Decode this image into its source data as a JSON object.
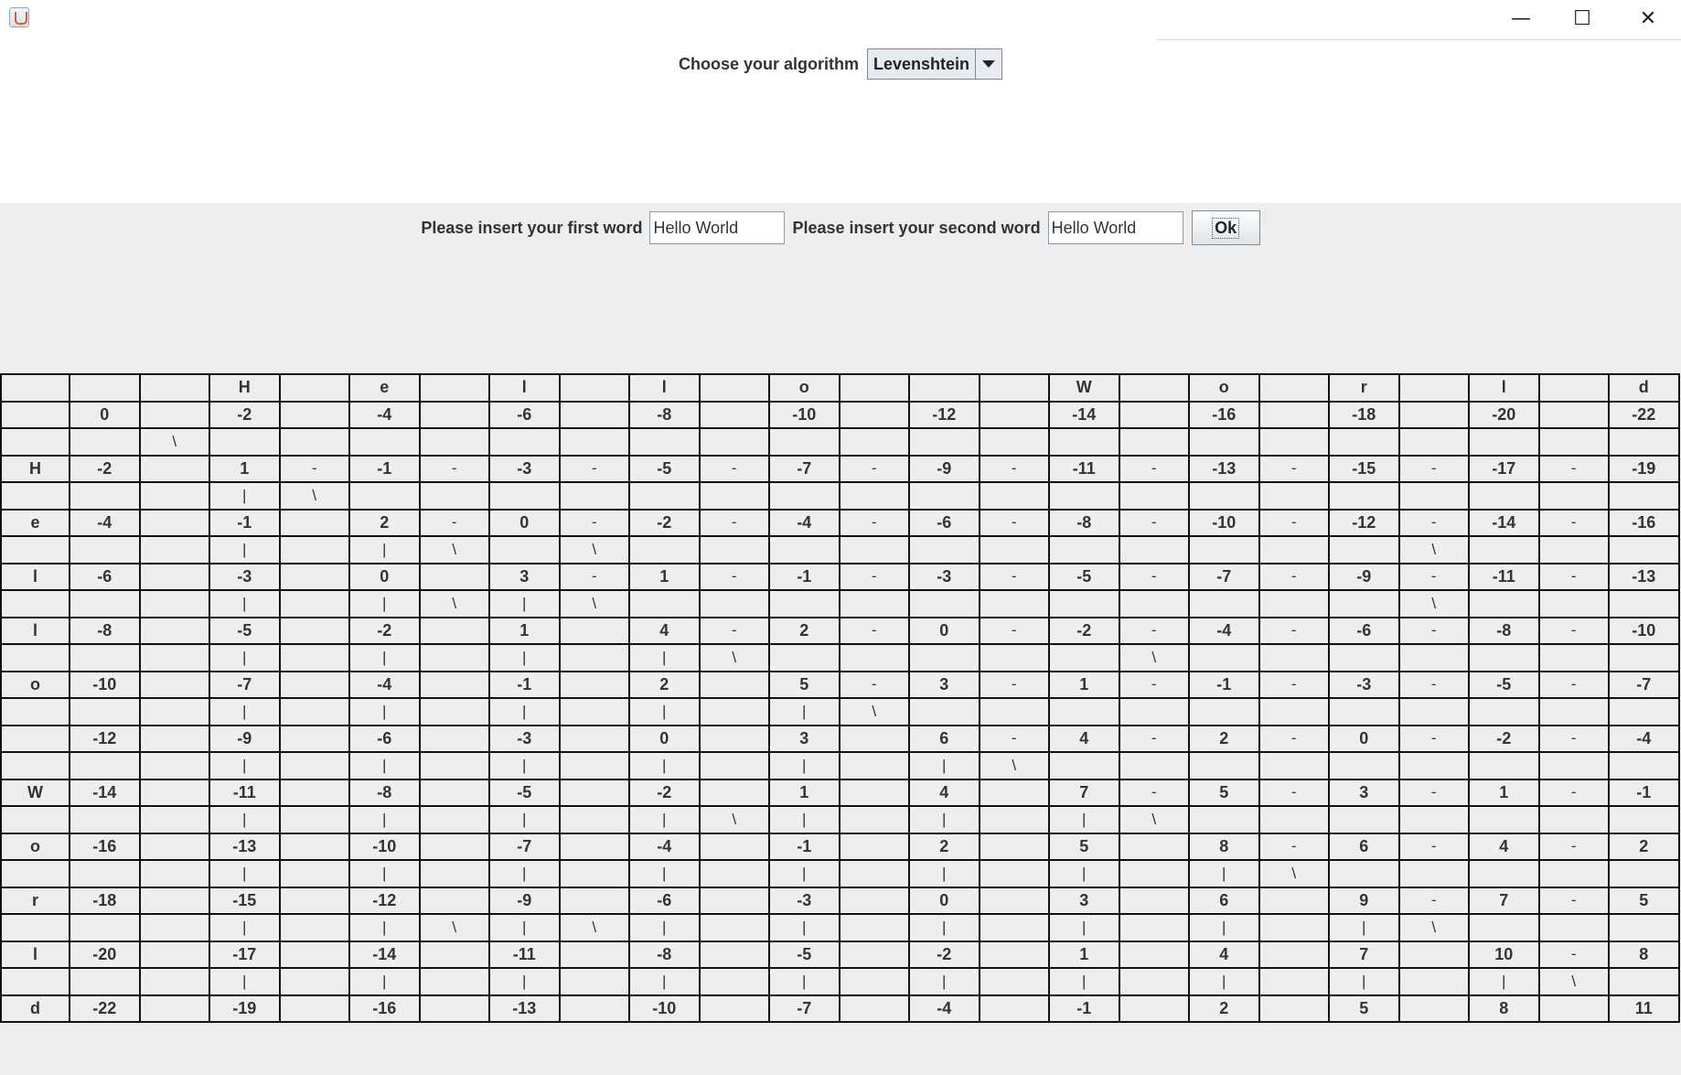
{
  "window": {
    "icon": "java-app-icon",
    "controls": {
      "minimize": "—",
      "maximize": "☐",
      "close": "✕"
    }
  },
  "algorithm": {
    "label": "Choose your algorithm",
    "selected": "Levenshtein"
  },
  "inputs": {
    "first_label": "Please insert your first word",
    "first_value": "Hello World",
    "second_label": "Please insert your second word",
    "second_value": "Hello World",
    "ok_label": "Ok"
  },
  "matrix": {
    "rows": [
      [
        "",
        "",
        "",
        "H",
        "",
        "e",
        "",
        "l",
        "",
        "l",
        "",
        "o",
        "",
        "",
        "",
        "W",
        "",
        "o",
        "",
        "r",
        "",
        "l",
        "",
        "d"
      ],
      [
        "",
        "0",
        "",
        "-2",
        "",
        "-4",
        "",
        "-6",
        "",
        "-8",
        "",
        "-10",
        "",
        "-12",
        "",
        "-14",
        "",
        "-16",
        "",
        "-18",
        "",
        "-20",
        "",
        "-22"
      ],
      [
        "",
        "",
        "\\",
        "",
        "",
        "",
        "",
        "",
        "",
        "",
        "",
        "",
        "",
        "",
        "",
        "",
        "",
        "",
        "",
        "",
        "",
        "",
        "",
        ""
      ],
      [
        "H",
        "-2",
        "",
        "1",
        "-",
        "-1",
        "-",
        "-3",
        "-",
        "-5",
        "-",
        "-7",
        "-",
        "-9",
        "-",
        "-11",
        "-",
        "-13",
        "-",
        "-15",
        "-",
        "-17",
        "-",
        "-19"
      ],
      [
        "",
        "",
        "",
        "|",
        "\\",
        "",
        "",
        "",
        "",
        "",
        "",
        "",
        "",
        "",
        "",
        "",
        "",
        "",
        "",
        "",
        "",
        "",
        "",
        ""
      ],
      [
        "e",
        "-4",
        "",
        "-1",
        "",
        "2",
        "-",
        "0",
        "-",
        "-2",
        "-",
        "-4",
        "-",
        "-6",
        "-",
        "-8",
        "-",
        "-10",
        "-",
        "-12",
        "-",
        "-14",
        "-",
        "-16"
      ],
      [
        "",
        "",
        "",
        "|",
        "",
        "|",
        "\\",
        "",
        "\\",
        "",
        "",
        "",
        "",
        "",
        "",
        "",
        "",
        "",
        "",
        "",
        "\\",
        "",
        "",
        ""
      ],
      [
        "l",
        "-6",
        "",
        "-3",
        "",
        "0",
        "",
        "3",
        "-",
        "1",
        "-",
        "-1",
        "-",
        "-3",
        "-",
        "-5",
        "-",
        "-7",
        "-",
        "-9",
        "-",
        "-11",
        "-",
        "-13"
      ],
      [
        "",
        "",
        "",
        "|",
        "",
        "|",
        "\\",
        "|",
        "\\",
        "",
        "",
        "",
        "",
        "",
        "",
        "",
        "",
        "",
        "",
        "",
        "\\",
        "",
        "",
        ""
      ],
      [
        "l",
        "-8",
        "",
        "-5",
        "",
        "-2",
        "",
        "1",
        "",
        "4",
        "-",
        "2",
        "-",
        "0",
        "-",
        "-2",
        "-",
        "-4",
        "-",
        "-6",
        "-",
        "-8",
        "-",
        "-10"
      ],
      [
        "",
        "",
        "",
        "|",
        "",
        "|",
        "",
        "|",
        "",
        "|",
        "\\",
        "",
        "",
        "",
        "",
        "",
        "\\",
        "",
        "",
        "",
        "",
        "",
        "",
        ""
      ],
      [
        "o",
        "-10",
        "",
        "-7",
        "",
        "-4",
        "",
        "-1",
        "",
        "2",
        "",
        "5",
        "-",
        "3",
        "-",
        "1",
        "-",
        "-1",
        "-",
        "-3",
        "-",
        "-5",
        "-",
        "-7"
      ],
      [
        "",
        "",
        "",
        "|",
        "",
        "|",
        "",
        "|",
        "",
        "|",
        "",
        "|",
        "\\",
        "",
        "",
        "",
        "",
        "",
        "",
        "",
        "",
        "",
        "",
        ""
      ],
      [
        "",
        "-12",
        "",
        "-9",
        "",
        "-6",
        "",
        "-3",
        "",
        "0",
        "",
        "3",
        "",
        "6",
        "-",
        "4",
        "-",
        "2",
        "-",
        "0",
        "-",
        "-2",
        "-",
        "-4"
      ],
      [
        "",
        "",
        "",
        "|",
        "",
        "|",
        "",
        "|",
        "",
        "|",
        "",
        "|",
        "",
        "|",
        "\\",
        "",
        "",
        "",
        "",
        "",
        "",
        "",
        "",
        ""
      ],
      [
        "W",
        "-14",
        "",
        "-11",
        "",
        "-8",
        "",
        "-5",
        "",
        "-2",
        "",
        "1",
        "",
        "4",
        "",
        "7",
        "-",
        "5",
        "-",
        "3",
        "-",
        "1",
        "-",
        "-1"
      ],
      [
        "",
        "",
        "",
        "|",
        "",
        "|",
        "",
        "|",
        "",
        "|",
        "\\",
        "|",
        "",
        "|",
        "",
        "|",
        "\\",
        "",
        "",
        "",
        "",
        "",
        "",
        ""
      ],
      [
        "o",
        "-16",
        "",
        "-13",
        "",
        "-10",
        "",
        "-7",
        "",
        "-4",
        "",
        "-1",
        "",
        "2",
        "",
        "5",
        "",
        "8",
        "-",
        "6",
        "-",
        "4",
        "-",
        "2"
      ],
      [
        "",
        "",
        "",
        "|",
        "",
        "|",
        "",
        "|",
        "",
        "|",
        "",
        "|",
        "",
        "|",
        "",
        "|",
        "",
        "|",
        "\\",
        "",
        "",
        "",
        "",
        ""
      ],
      [
        "r",
        "-18",
        "",
        "-15",
        "",
        "-12",
        "",
        "-9",
        "",
        "-6",
        "",
        "-3",
        "",
        "0",
        "",
        "3",
        "",
        "6",
        "",
        "9",
        "-",
        "7",
        "-",
        "5"
      ],
      [
        "",
        "",
        "",
        "|",
        "",
        "|",
        "\\",
        "|",
        "\\",
        "|",
        "",
        "|",
        "",
        "|",
        "",
        "|",
        "",
        "|",
        "",
        "|",
        "\\",
        "",
        "",
        ""
      ],
      [
        "l",
        "-20",
        "",
        "-17",
        "",
        "-14",
        "",
        "-11",
        "",
        "-8",
        "",
        "-5",
        "",
        "-2",
        "",
        "1",
        "",
        "4",
        "",
        "7",
        "",
        "10",
        "-",
        "8"
      ],
      [
        "",
        "",
        "",
        "|",
        "",
        "|",
        "",
        "|",
        "",
        "|",
        "",
        "|",
        "",
        "|",
        "",
        "|",
        "",
        "|",
        "",
        "|",
        "",
        "|",
        "\\",
        ""
      ],
      [
        "d",
        "-22",
        "",
        "-19",
        "",
        "-16",
        "",
        "-13",
        "",
        "-10",
        "",
        "-7",
        "",
        "-4",
        "",
        "-1",
        "",
        "2",
        "",
        "5",
        "",
        "8",
        "",
        "11"
      ]
    ]
  }
}
